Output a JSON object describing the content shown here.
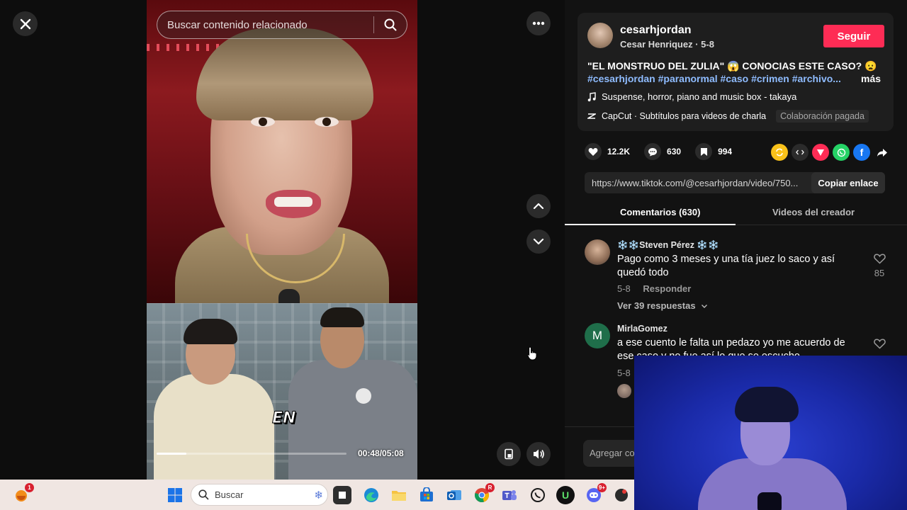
{
  "player": {
    "search_placeholder": "Buscar contenido relacionado",
    "caption_word": "EN",
    "time_display": "00:48/05:08",
    "progress_fraction": 0.156
  },
  "post": {
    "username": "cesarhjordan",
    "subline": "Cesar Henriquez · 5-8",
    "follow_label": "Seguir",
    "description": "\"EL MONSTRUO DEL ZULIA\" 😱 CONOCIAS ESTE CASO? 😦",
    "hashtags": "#cesarhjordan #paranormal #caso #crimen #archivo...",
    "more_label": "más",
    "music": "Suspense, horror, piano and music box - takaya",
    "capcut": "CapCut · Subtítulos para videos de charla",
    "paid_label": "Colaboración pagada"
  },
  "stats": {
    "likes": "12.2K",
    "comments": "630",
    "saves": "994"
  },
  "share": {
    "link": "https://www.tiktok.com/@cesarhjordan/video/750...",
    "copy_label": "Copiar enlace",
    "colors": {
      "repost": "#f9c21a",
      "embed": "#2b2b2b",
      "send": "#fe2c55",
      "whatsapp": "#25d366",
      "facebook": "#1877f2"
    }
  },
  "tabs": {
    "comments": "Comentarios (630)",
    "creator_videos": "Videos del creador"
  },
  "comments": [
    {
      "name": "❄️❄️Steven Pérez ❄️❄️",
      "text": "Pago como 3 meses y una tía juez lo saco y así quedó todo",
      "date": "5-8",
      "reply_label": "Responder",
      "likes": "85",
      "view_replies": "Ver 39 respuestas"
    },
    {
      "name": "MirlaGomez",
      "avatar_letter": "M",
      "text": "a ese cuento le falta un pedazo yo me acuerdo de ese caso y no fue así lo que se escucho",
      "date": "5-8"
    }
  ],
  "composer": {
    "placeholder": "Agregar co"
  },
  "taskbar": {
    "search_label": "Buscar",
    "weather_badge": "1",
    "chrome_badge": "R",
    "discord_badge": "9+"
  }
}
